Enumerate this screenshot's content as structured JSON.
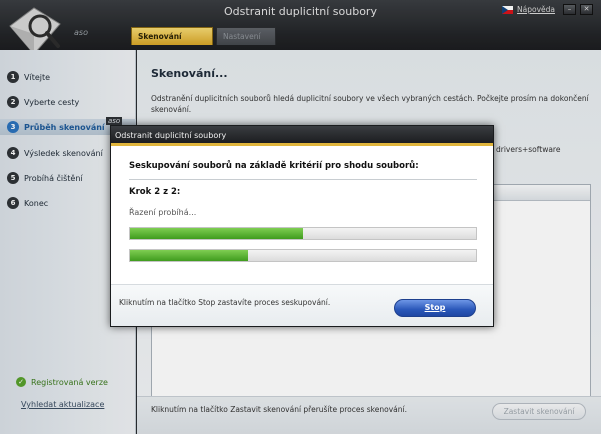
{
  "window": {
    "title": "Odstranit duplicitní soubory",
    "help_label": "Nápověda",
    "minimize": "–",
    "close": "✕"
  },
  "brand": "aso",
  "tabs": [
    {
      "label": "Skenování systému",
      "active": true
    },
    {
      "label": "Nastavení",
      "active": false
    }
  ],
  "sidebar": {
    "steps": [
      {
        "num": "1",
        "label": "Vítejte"
      },
      {
        "num": "2",
        "label": "Vyberte cesty"
      },
      {
        "num": "3",
        "label": "Průběh skenování",
        "active": true
      },
      {
        "num": "4",
        "label": "Výsledek skenování"
      },
      {
        "num": "5",
        "label": "Probíhá čištění"
      },
      {
        "num": "6",
        "label": "Konec"
      }
    ],
    "registered": "Registrovaná verze",
    "update_link": "Vyhledat aktualizace"
  },
  "main": {
    "title": "Skenování...",
    "description": "Odstranění duplicitních souborů hledá duplicitní soubory ve všech vybraných cestách. Počkejte prosím na dokončení skenování.",
    "fragment": "drivers+software",
    "bottom_hint": "Kliknutím na tlačítko Zastavit skenování přerušíte proces skenování.",
    "stop_scan_label": "Zastavit skenování"
  },
  "modal": {
    "brand": "aso",
    "title": "Odstranit duplicitní soubory",
    "heading": "Seskupování souborů na základě kritérií pro shodu souborů:",
    "step": "Krok 2 z 2:",
    "status": "Řazení probíhá...",
    "progress_primary": 0.5,
    "progress_secondary": 0.34,
    "footer_text": "Kliknutím na tlačítko Stop zastavíte proces seskupování.",
    "stop_label": "Stop"
  },
  "colors": {
    "accent_gold": "#e0b53c",
    "progress_green": "#3f9c1e",
    "active_step_blue": "#1d5a9a",
    "stop_button_blue": "#2a57b9"
  }
}
